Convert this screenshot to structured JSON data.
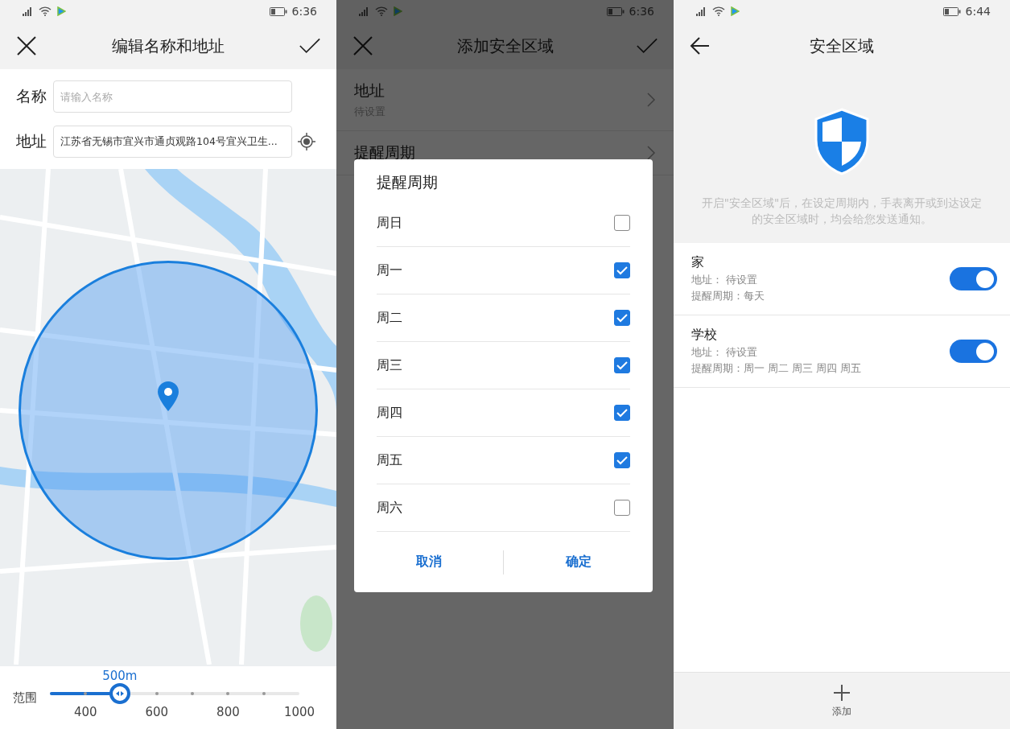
{
  "edit_screen": {
    "status_bar": {
      "time": "6:36"
    },
    "title": "编辑名称和地址",
    "name_field": {
      "label": "名称",
      "placeholder": "请输入名称"
    },
    "address_field": {
      "label": "地址",
      "value": "江苏省无锡市宜兴市通贞观路104号宜兴卫生..."
    },
    "range_slider": {
      "label": "范围",
      "reading": "500m",
      "level": 0.28,
      "ticks": [
        "400",
        "600",
        "800",
        "1000"
      ]
    }
  },
  "add_screen": {
    "status_bar": {
      "time": "6:36"
    },
    "title": "添加安全区域",
    "rows": [
      {
        "label": "地址",
        "value": "待设置"
      },
      {
        "label": "提醒周期"
      }
    ],
    "dialog": {
      "title": "提醒周期",
      "options": [
        {
          "label": "周日",
          "checked": false
        },
        {
          "label": "周一",
          "checked": true
        },
        {
          "label": "周二",
          "checked": true
        },
        {
          "label": "周三",
          "checked": true
        },
        {
          "label": "周四",
          "checked": true
        },
        {
          "label": "周五",
          "checked": true
        },
        {
          "label": "周六",
          "checked": false
        }
      ],
      "buttons": [
        "取消",
        "确定"
      ]
    }
  },
  "zones_screen": {
    "status_bar": {
      "time": "6:44"
    },
    "title": "安全区域",
    "description": "开启\"安全区域\"后，在设定周期内，手表离开或到达设定的安全区域时，均会给您发送通知。",
    "zones": [
      {
        "name": "家",
        "address": "地址： 待设置",
        "period": "提醒周期：每天",
        "on": true
      },
      {
        "name": "学校",
        "address": "地址： 待设置",
        "period": "提醒周期：周一 周二 周三 周四 周五",
        "on": true
      }
    ],
    "add_button": "添加"
  }
}
